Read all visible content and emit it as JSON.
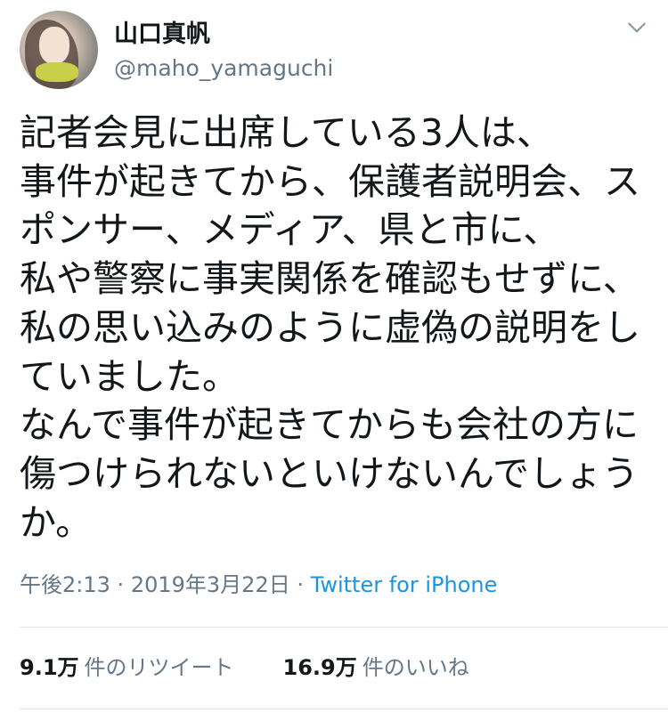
{
  "user": {
    "display_name": "山口真帆",
    "handle": "@maho_yamaguchi"
  },
  "header": {
    "menu_icon": "chevron-down-icon"
  },
  "tweet": {
    "text": "記者会見に出席している3人は、\n事件が起きてから、保護者説明会、ス\nポンサー、メディア、県と市に、\n私や警察に事実関係を確認もせずに、\n私の思い込みのように虚偽の説明をし\nていました。\nなんで事件が起きてからも会社の方に\n傷つけられないといけないんでしょう\nか。"
  },
  "meta": {
    "time": "午後2:13",
    "separator1": "·",
    "date": "2019年3月22日",
    "separator2": "·",
    "source": "Twitter for iPhone"
  },
  "stats": {
    "retweets_count": "9.1万",
    "retweets_label": "件のリツイート",
    "likes_count": "16.9万",
    "likes_label": "件のいいね"
  },
  "colors": {
    "text": "#14171a",
    "secondary": "#657786",
    "link": "#1b95e0",
    "divider": "#e1e8ed"
  }
}
